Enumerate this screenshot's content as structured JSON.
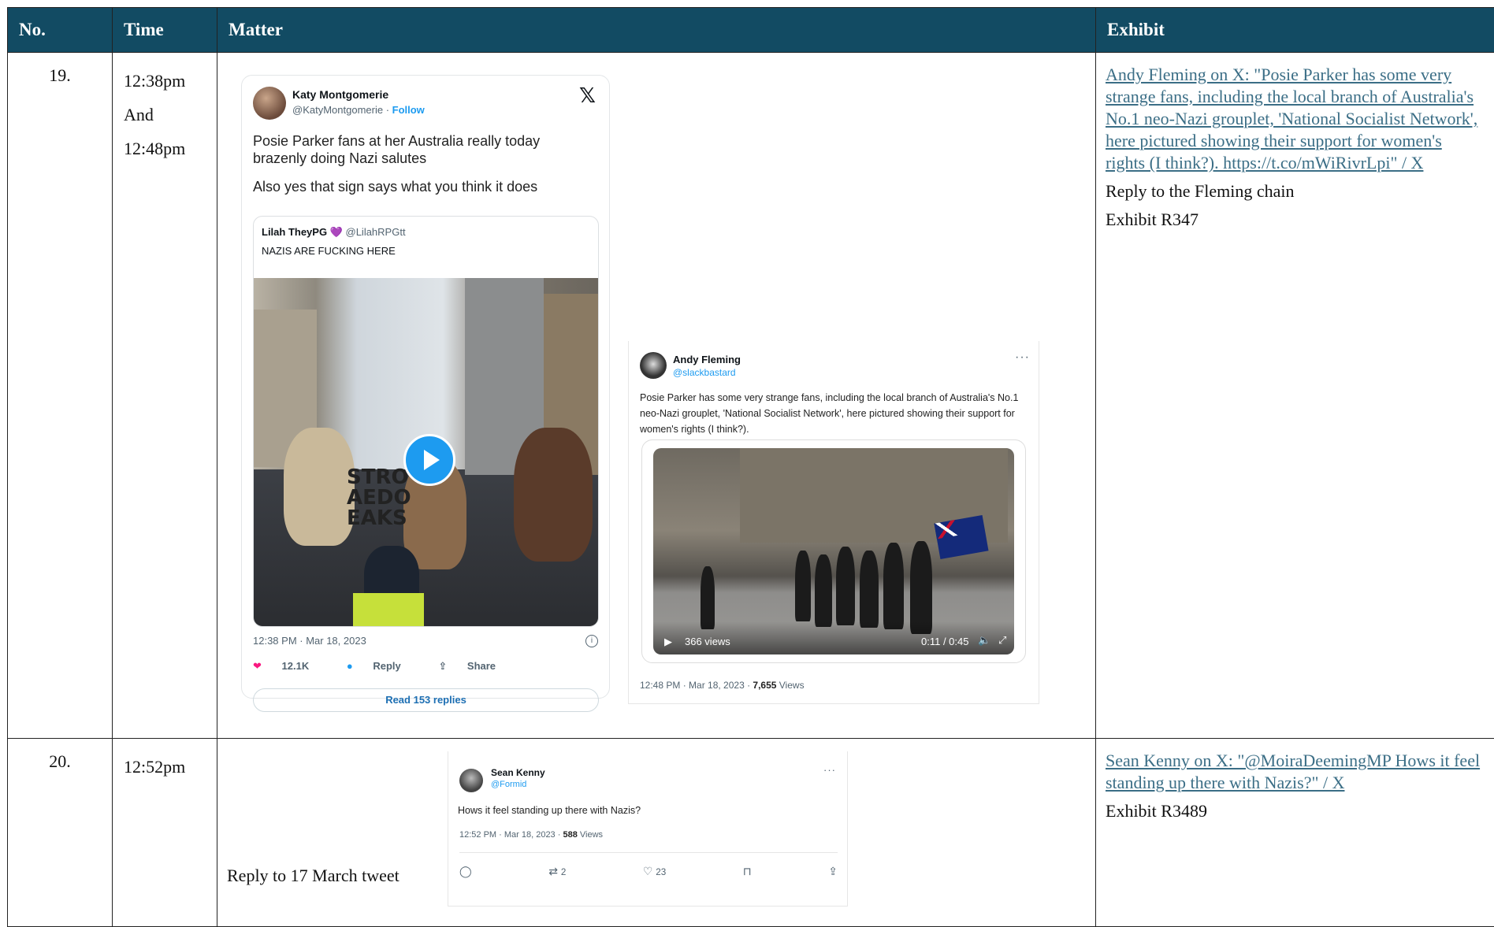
{
  "header": {
    "no": "No.",
    "time": "Time",
    "matter": "Matter",
    "exhibit": "Exhibit"
  },
  "rows": [
    {
      "no": "19.",
      "time": [
        "12:38pm",
        "And",
        "12:48pm"
      ],
      "tweet_main": {
        "name": "Katy Montgomerie",
        "handle": "@KatyMontgomerie",
        "follow": "Follow",
        "x_logo": "𝕏",
        "text_line1": "Posie Parker fans at her Australia really today",
        "text_line2": "brazenly doing Nazi salutes",
        "text_line3": "Also yes that sign says what you think it does",
        "quote_name": "Lilah TheyPG 💜",
        "quote_handle": "@LilahRPGtt",
        "quote_text": "NAZIS ARE FUCKING HERE",
        "sign_text": "STRO\nAEDO\nEAKS",
        "timestamp": "12:38 PM · Mar 18, 2023",
        "likes": "12.1K",
        "reply": "Reply",
        "share": "Share",
        "read_replies": "Read 153 replies"
      },
      "tweet_fleming": {
        "name": "Andy Fleming",
        "handle": "@slackbastard",
        "dots": "···",
        "text": "Posie Parker has some very strange fans, including the local branch of Australia's No.1 neo-Nazi grouplet, 'National Socialist Network', here pictured showing their support for women's rights (I think?).",
        "views_label": "366 views",
        "video_time": "0:11 / 0:45",
        "timestamp": "12:48 PM · Mar 18, 2023 · ",
        "view_count": "7,655",
        "views_word": " Views"
      },
      "exhibit_link": "Andy Fleming on X: \"Posie Parker has some very strange fans, including the local branch of Australia's No.1 neo-Nazi grouplet, 'National Socialist Network', here pictured showing their support for women's rights (I think?). https://t.co/mWiRivrLpi\" / X",
      "exhibit_note": "Reply to the Fleming chain",
      "exhibit_id": "Exhibit R347"
    },
    {
      "no": "20.",
      "time": [
        "12:52pm"
      ],
      "matter_note": "Reply to 17 March tweet",
      "tweet_kenny": {
        "name": "Sean Kenny",
        "handle": "@Formid",
        "dots": "···",
        "text": "Hows it feel standing up there with Nazis?",
        "timestamp": "12:52 PM · Mar 18, 2023 · ",
        "view_count": "588",
        "views_word": " Views",
        "retweets": "2",
        "likes": "23"
      },
      "exhibit_link": "Sean Kenny on X: \"@MoiraDeemingMP Hows it feel standing up there with Nazis?\" / X",
      "exhibit_id": "Exhibit R3489"
    }
  ],
  "colors": {
    "header_bg": "#124b63",
    "link": "#3b6e86",
    "twitter_blue": "#1d9bf0",
    "like_pink": "#f91880"
  },
  "icons": [
    "x-logo-icon",
    "play-icon",
    "heart-icon",
    "reply-bubble-icon",
    "share-icon",
    "info-icon",
    "more-dots-icon",
    "retweet-icon",
    "bookmark-icon",
    "volume-icon",
    "fullscreen-icon"
  ]
}
